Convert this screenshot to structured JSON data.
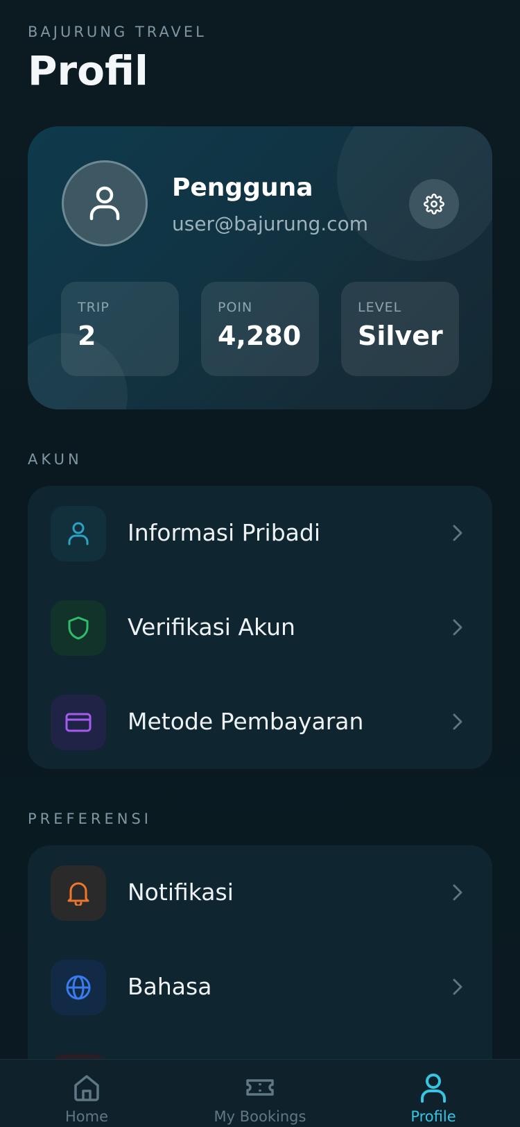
{
  "header": {
    "eyebrow": "BAJURUNG TRAVEL",
    "title": "Profil"
  },
  "profile": {
    "name": "Pengguna",
    "email": "user@bajurung.com",
    "avatar_icon": "user-icon",
    "settings_icon": "gear-icon"
  },
  "stats": [
    {
      "label": "TRIP",
      "value": "2"
    },
    {
      "label": "POIN",
      "value": "4,280"
    },
    {
      "label": "LEVEL",
      "value": "Silver"
    }
  ],
  "sections": {
    "akun": {
      "label": "AKUN",
      "items": [
        {
          "label": "Informasi Pribadi",
          "icon": "user-icon",
          "color": "#2aa3c4"
        },
        {
          "label": "Verifikasi Akun",
          "icon": "shield-icon",
          "color": "#2ebd6b"
        },
        {
          "label": "Metode Pembayaran",
          "icon": "credit-card-icon",
          "color": "#a55bf0"
        }
      ]
    },
    "preferensi": {
      "label": "PREFERENSI",
      "items": [
        {
          "label": "Notifikasi",
          "icon": "bell-icon",
          "color": "#f0762c"
        },
        {
          "label": "Bahasa",
          "icon": "globe-icon",
          "color": "#3a7cf0"
        }
      ]
    }
  },
  "tabbar": {
    "items": [
      {
        "label": "Home",
        "icon": "home-icon"
      },
      {
        "label": "My Bookings",
        "icon": "ticket-icon"
      },
      {
        "label": "Profile",
        "icon": "user-icon"
      }
    ],
    "active": "Profile",
    "active_color": "#35c6e3"
  }
}
